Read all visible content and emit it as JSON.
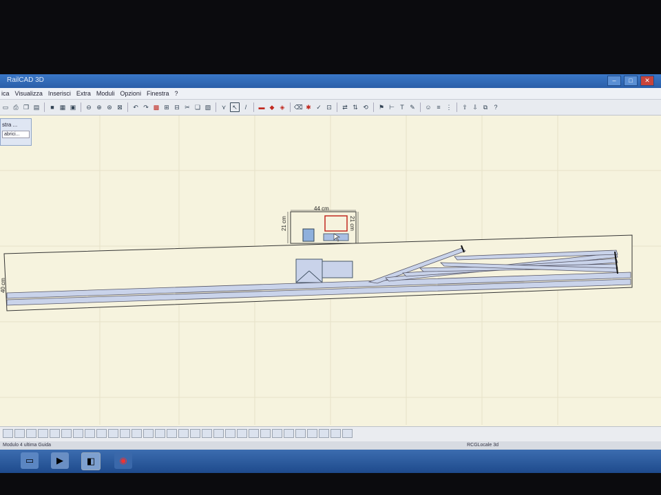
{
  "window": {
    "title": "RailCAD 3D"
  },
  "menu": [
    "ica",
    "Visualizza",
    "Inserisci",
    "Extra",
    "Moduli",
    "Opzioni",
    "Finestra",
    "?"
  ],
  "toolbar_icons": [
    "page-icon",
    "print-icon",
    "copy-icon",
    "doc-icon",
    "book-icon",
    "table-icon",
    "image-icon",
    "zoom-out-icon",
    "zoom-in-icon",
    "zoom-fit-icon",
    "zoom-window-icon",
    "undo-icon",
    "redo-icon",
    "grid-icon",
    "select-icon",
    "layout-icon",
    "cut-icon",
    "copy2-icon",
    "paste-icon",
    "pointer-icon",
    "line-icon",
    "track-icon",
    "rail-icon",
    "rail-red-icon",
    "eraser-icon",
    "joint-icon",
    "check-icon",
    "wagon-icon",
    "connect-icon",
    "measure-icon",
    "text-icon",
    "pen-icon",
    "help-icon"
  ],
  "float_panel": {
    "title": "stra ...",
    "dropdown": "abrici..."
  },
  "dimensions": {
    "width_label": "44 cm",
    "height_left": "21 cm",
    "height_right": "21 cm",
    "base_height": "40 cm"
  },
  "status": {
    "left": "Modulo 4 ultima Guida",
    "center": "RCGLocale 3d"
  },
  "colors": {
    "canvas": "#f6f3de",
    "track": "#c9d3ea",
    "red_accent": "#c0281e"
  }
}
